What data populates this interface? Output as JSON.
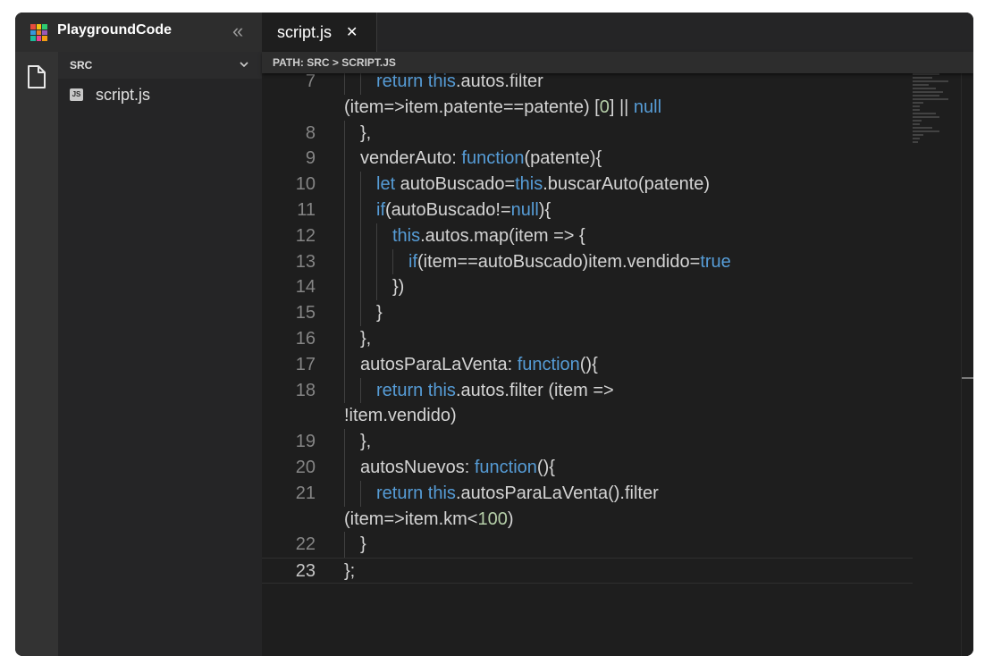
{
  "app": {
    "title": "PlaygroundCode",
    "collapse_icon": "«"
  },
  "logo_colors": [
    "#e74c3c",
    "#f1c40f",
    "#2ecc71",
    "#3498db",
    "#e67e22",
    "#9b59b6",
    "#1abc9c",
    "#e84393",
    "#f39c12"
  ],
  "sidebar": {
    "folder_label": "SRC",
    "files": [
      {
        "name": "script.js",
        "badge": "JS"
      }
    ]
  },
  "tabs": [
    {
      "label": "script.js",
      "close": "✕"
    }
  ],
  "breadcrumb": "PATH: SRC > SCRIPT.JS",
  "editor": {
    "current_line": "23",
    "lines": [
      {
        "num": "7",
        "tokens": [
          {
            "t": "return this",
            "c": "kw"
          },
          {
            "t": ".autos.filter",
            "c": ""
          }
        ]
      },
      {
        "num": "",
        "tokens": [
          {
            "t": "(item=>item.patente==patente) [",
            "c": ""
          },
          {
            "t": "0",
            "c": "num"
          },
          {
            "t": "] || ",
            "c": ""
          },
          {
            "t": "null",
            "c": "kw"
          }
        ]
      },
      {
        "num": "8",
        "tokens": [
          {
            "t": "},",
            "c": ""
          }
        ]
      },
      {
        "num": "9",
        "tokens": [
          {
            "t": "venderAuto: ",
            "c": ""
          },
          {
            "t": "function",
            "c": "kw"
          },
          {
            "t": "(patente){",
            "c": ""
          }
        ]
      },
      {
        "num": "10",
        "tokens": [
          {
            "t": "let",
            "c": "kw"
          },
          {
            "t": " autoBuscado=",
            "c": ""
          },
          {
            "t": "this",
            "c": "kw"
          },
          {
            "t": ".buscarAuto(patente)",
            "c": ""
          }
        ]
      },
      {
        "num": "11",
        "tokens": [
          {
            "t": "if",
            "c": "kw"
          },
          {
            "t": "(autoBuscado!=",
            "c": ""
          },
          {
            "t": "null",
            "c": "kw"
          },
          {
            "t": "){",
            "c": ""
          }
        ]
      },
      {
        "num": "12",
        "tokens": [
          {
            "t": "this",
            "c": "kw"
          },
          {
            "t": ".autos.map(item => {",
            "c": ""
          }
        ]
      },
      {
        "num": "13",
        "tokens": [
          {
            "t": "if",
            "c": "kw"
          },
          {
            "t": "(item==autoBuscado)item.vendido=",
            "c": ""
          },
          {
            "t": "true",
            "c": "kw"
          }
        ]
      },
      {
        "num": "14",
        "tokens": [
          {
            "t": "})",
            "c": ""
          }
        ]
      },
      {
        "num": "15",
        "tokens": [
          {
            "t": "}",
            "c": ""
          }
        ]
      },
      {
        "num": "16",
        "tokens": [
          {
            "t": "},",
            "c": ""
          }
        ]
      },
      {
        "num": "17",
        "tokens": [
          {
            "t": "autosParaLaVenta: ",
            "c": ""
          },
          {
            "t": "function",
            "c": "kw"
          },
          {
            "t": "(){",
            "c": ""
          }
        ]
      },
      {
        "num": "18",
        "tokens": [
          {
            "t": "return this",
            "c": "kw"
          },
          {
            "t": ".autos.filter (item =>",
            "c": ""
          }
        ]
      },
      {
        "num": "",
        "tokens": [
          {
            "t": "!item.vendido)",
            "c": ""
          }
        ]
      },
      {
        "num": "19",
        "tokens": [
          {
            "t": "},",
            "c": ""
          }
        ]
      },
      {
        "num": "20",
        "tokens": [
          {
            "t": "autosNuevos: ",
            "c": ""
          },
          {
            "t": "function",
            "c": "kw"
          },
          {
            "t": "(){",
            "c": ""
          }
        ]
      },
      {
        "num": "21",
        "tokens": [
          {
            "t": "return this",
            "c": "kw"
          },
          {
            "t": ".autosParaLaVenta().filter",
            "c": ""
          }
        ]
      },
      {
        "num": "",
        "tokens": [
          {
            "t": "(item=>item.km<",
            "c": ""
          },
          {
            "t": "100",
            "c": "num"
          },
          {
            "t": ")",
            "c": ""
          }
        ]
      },
      {
        "num": "22",
        "tokens": [
          {
            "t": "}",
            "c": ""
          }
        ]
      },
      {
        "num": "23",
        "tokens": [
          {
            "t": "};",
            "c": ""
          }
        ]
      }
    ]
  }
}
